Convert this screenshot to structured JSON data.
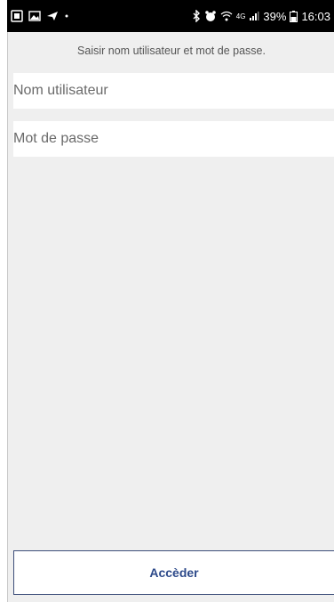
{
  "status_bar": {
    "left_icons": [
      "sim-card-icon",
      "image-icon",
      "send-icon",
      "dot-icon"
    ],
    "right_icons": [
      "bluetooth-icon",
      "alarm-icon",
      "wifi-icon"
    ],
    "network": "4G",
    "battery_percent": "39%",
    "time": "16:03"
  },
  "login": {
    "prompt": "Saisir nom utilisateur et mot de passe.",
    "username_placeholder": "Nom utilisateur",
    "password_placeholder": "Mot de passe",
    "submit_label": "Accèder"
  },
  "colors": {
    "status_bar_bg": "#000000",
    "app_bg": "#efefef",
    "button_text": "#2d4a8a",
    "button_border": "#3d4f7a"
  }
}
